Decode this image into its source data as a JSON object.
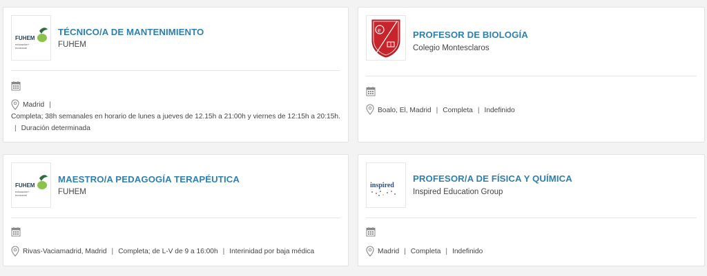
{
  "cards": [
    {
      "logo": "fuhem-logo",
      "logo_text": "FUHEM",
      "logo_sub": "educación+ ecosocial",
      "title": "TÉCNICO/A DE MANTENIMIENTO",
      "company": "FUHEM",
      "location": "Madrid",
      "details": "Completa; 38h semanales en horario de lunes a jueves de 12.15h a 21:00h y viernes de 12:15h a 20:15h.",
      "contract": "Duración determinada"
    },
    {
      "logo": "montesclaros-shield-logo",
      "title": "PROFESOR DE BIOLOGÍA",
      "company": "Colegio Montesclaros",
      "location": "Boalo, El, Madrid",
      "details": "Completa",
      "contract": "Indefinido"
    },
    {
      "logo": "fuhem-logo",
      "logo_text": "FUHEM",
      "logo_sub": "educación+ ecosocial",
      "title": "MAESTRO/A PEDAGOGÍA TERAPÉUTICA",
      "company": "FUHEM",
      "location": "Rivas-Vaciamadrid, Madrid",
      "details": "Completa; de L-V de 9 a 16:00h",
      "contract": "Interinidad por baja médica"
    },
    {
      "logo": "inspired-logo",
      "logo_text": "inspired",
      "title": "PROFESOR/A DE FÍSICA Y QUÍMICA",
      "company": "Inspired Education Group",
      "location": "Madrid",
      "details": "Completa",
      "contract": "Indefinido"
    }
  ],
  "separator": "|",
  "icons": {
    "calendar": "calendar-icon",
    "location": "location-pin-icon"
  },
  "colors": {
    "title": "#2f7fad",
    "fuhem_green": "#6aa42f",
    "montesclaros_red": "#c8242c",
    "inspired_blue": "#2a4f8f"
  }
}
